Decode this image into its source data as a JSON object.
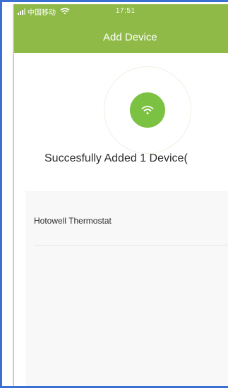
{
  "status_bar": {
    "carrier": "中国移动",
    "time": "17:51"
  },
  "header": {
    "title": "Add Device"
  },
  "main": {
    "status_icon": "wifi-icon",
    "success_message": "Succesfully Added 1 Device("
  },
  "devices": [
    {
      "name": "Hotowell Thermostat"
    }
  ],
  "colors": {
    "header_bg": "#8fba48",
    "wifi_badge": "#7bc142"
  }
}
